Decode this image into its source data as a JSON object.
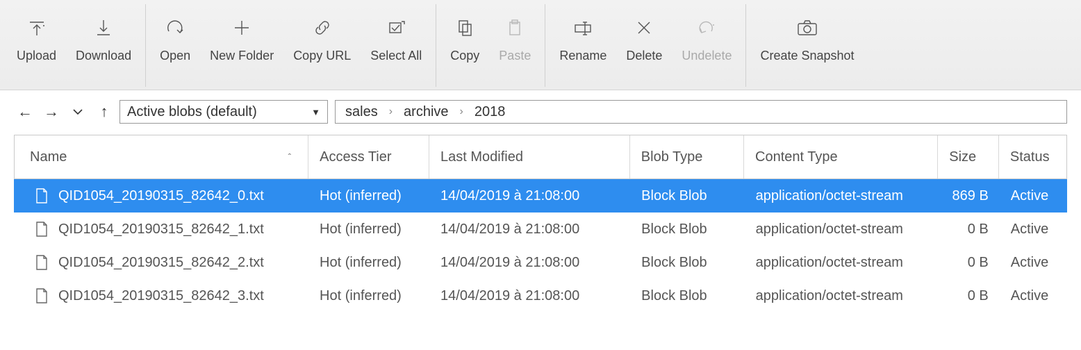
{
  "toolbar": {
    "upload": "Upload",
    "download": "Download",
    "open": "Open",
    "new_folder": "New Folder",
    "copy_url": "Copy URL",
    "select_all": "Select All",
    "copy": "Copy",
    "paste": "Paste",
    "rename": "Rename",
    "delete": "Delete",
    "undelete": "Undelete",
    "snapshot": "Create Snapshot"
  },
  "filter": {
    "selected": "Active blobs (default)"
  },
  "breadcrumb": {
    "0": "sales",
    "1": "archive",
    "2": "2018"
  },
  "columns": {
    "name": "Name",
    "tier": "Access Tier",
    "modified": "Last Modified",
    "blob": "Blob Type",
    "ctype": "Content Type",
    "size": "Size",
    "status": "Status"
  },
  "rows": [
    {
      "name": "QID1054_20190315_82642_0.txt",
      "tier": "Hot (inferred)",
      "modified": "14/04/2019 à 21:08:00",
      "blob": "Block Blob",
      "ctype": "application/octet-stream",
      "size": "869 B",
      "status": "Active",
      "selected": true
    },
    {
      "name": "QID1054_20190315_82642_1.txt",
      "tier": "Hot (inferred)",
      "modified": "14/04/2019 à 21:08:00",
      "blob": "Block Blob",
      "ctype": "application/octet-stream",
      "size": "0 B",
      "status": "Active",
      "selected": false
    },
    {
      "name": "QID1054_20190315_82642_2.txt",
      "tier": "Hot (inferred)",
      "modified": "14/04/2019 à 21:08:00",
      "blob": "Block Blob",
      "ctype": "application/octet-stream",
      "size": "0 B",
      "status": "Active",
      "selected": false
    },
    {
      "name": "QID1054_20190315_82642_3.txt",
      "tier": "Hot (inferred)",
      "modified": "14/04/2019 à 21:08:00",
      "blob": "Block Blob",
      "ctype": "application/octet-stream",
      "size": "0 B",
      "status": "Active",
      "selected": false
    }
  ]
}
